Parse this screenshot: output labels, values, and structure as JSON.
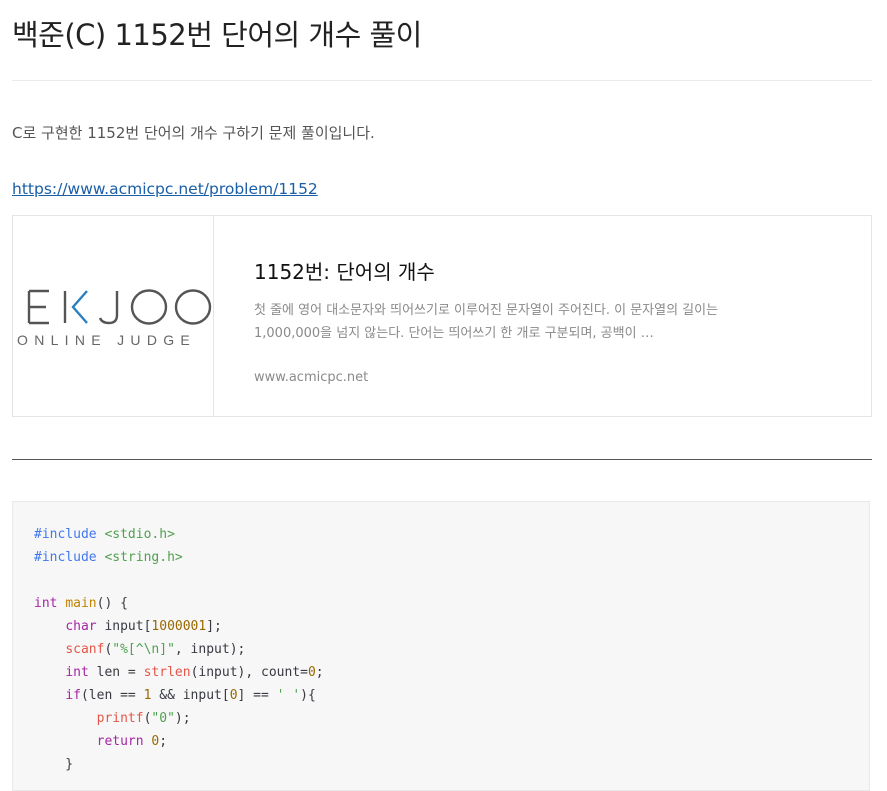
{
  "post": {
    "title": "백준(C) 1152번 단어의 개수 풀이",
    "intro": "C로 구현한 1152번 단어의 개수 구하기 문제 풀이입니다.",
    "link": "https://www.acmicpc.net/problem/1152"
  },
  "og_card": {
    "logo_text_top": "E K J O O",
    "logo_text_bottom": "ONLINE JUDGE",
    "title": "1152번: 단어의 개수",
    "description": "첫 줄에 영어 대소문자와 띄어쓰기로 이루어진 문자열이 주어진다. 이 문자열의 길이는 1,000,000을 넘지 않는다. 단어는 띄어쓰기 한 개로 구분되며, 공백이 …",
    "url": "www.acmicpc.net"
  },
  "code": {
    "lines": [
      [
        {
          "t": "#include ",
          "c": "pp"
        },
        {
          "t": "<stdio.h>",
          "c": "str"
        }
      ],
      [
        {
          "t": "#include ",
          "c": "pp"
        },
        {
          "t": "<string.h>",
          "c": "str"
        }
      ],
      [],
      [
        {
          "t": "int",
          "c": "kw"
        },
        {
          "t": " ",
          "c": "plain"
        },
        {
          "t": "main",
          "c": "fn"
        },
        {
          "t": "() {",
          "c": "plain"
        }
      ],
      [
        {
          "t": "    ",
          "c": "plain"
        },
        {
          "t": "char",
          "c": "kw"
        },
        {
          "t": " input[",
          "c": "plain"
        },
        {
          "t": "1000001",
          "c": "num"
        },
        {
          "t": "];",
          "c": "plain"
        }
      ],
      [
        {
          "t": "    ",
          "c": "plain"
        },
        {
          "t": "scanf",
          "c": "fn2"
        },
        {
          "t": "(",
          "c": "plain"
        },
        {
          "t": "\"%[^\\n]\"",
          "c": "str"
        },
        {
          "t": ", input);",
          "c": "plain"
        }
      ],
      [
        {
          "t": "    ",
          "c": "plain"
        },
        {
          "t": "int",
          "c": "kw"
        },
        {
          "t": " len = ",
          "c": "plain"
        },
        {
          "t": "strlen",
          "c": "fn2"
        },
        {
          "t": "(input), count=",
          "c": "plain"
        },
        {
          "t": "0",
          "c": "num"
        },
        {
          "t": ";",
          "c": "plain"
        }
      ],
      [
        {
          "t": "    ",
          "c": "plain"
        },
        {
          "t": "if",
          "c": "kw"
        },
        {
          "t": "(len == ",
          "c": "plain"
        },
        {
          "t": "1",
          "c": "num"
        },
        {
          "t": " && input[",
          "c": "plain"
        },
        {
          "t": "0",
          "c": "num"
        },
        {
          "t": "] == ",
          "c": "plain"
        },
        {
          "t": "' '",
          "c": "str"
        },
        {
          "t": "){",
          "c": "plain"
        }
      ],
      [
        {
          "t": "        ",
          "c": "plain"
        },
        {
          "t": "printf",
          "c": "fn2"
        },
        {
          "t": "(",
          "c": "plain"
        },
        {
          "t": "\"0\"",
          "c": "str"
        },
        {
          "t": ");",
          "c": "plain"
        }
      ],
      [
        {
          "t": "        ",
          "c": "plain"
        },
        {
          "t": "return",
          "c": "kw"
        },
        {
          "t": " ",
          "c": "plain"
        },
        {
          "t": "0",
          "c": "num"
        },
        {
          "t": ";",
          "c": "plain"
        }
      ],
      [
        {
          "t": "    }",
          "c": "plain"
        }
      ]
    ]
  },
  "colors": {
    "link": "#1a5ea8",
    "logo_blue": "#2a7fc1",
    "logo_gray": "#555555"
  }
}
